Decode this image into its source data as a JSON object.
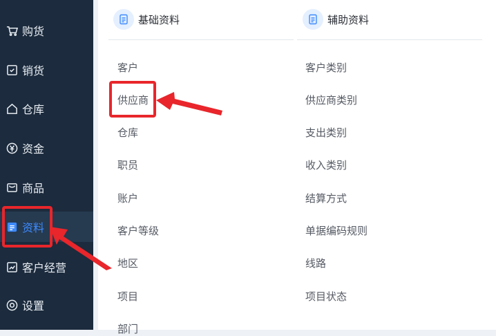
{
  "sidebar": {
    "items": [
      {
        "label": "购货",
        "icon": "cart-icon"
      },
      {
        "label": "销货",
        "icon": "receipt-icon"
      },
      {
        "label": "仓库",
        "icon": "warehouse-icon"
      },
      {
        "label": "资金",
        "icon": "money-icon"
      },
      {
        "label": "商品",
        "icon": "goods-icon"
      },
      {
        "label": "资料",
        "icon": "document-icon",
        "active": true
      },
      {
        "label": "客户经营",
        "icon": "chart-icon"
      },
      {
        "label": "设置",
        "icon": "settings-icon"
      }
    ]
  },
  "columns": [
    {
      "title": "基础资料",
      "icon": "document-icon",
      "items": [
        "客户",
        "供应商",
        "仓库",
        "职员",
        "账户",
        "客户等级",
        "地区",
        "项目",
        "部门"
      ]
    },
    {
      "title": "辅助资料",
      "icon": "document-icon",
      "items": [
        "客户类别",
        "供应商类别",
        "支出类别",
        "收入类别",
        "结算方式",
        "单据编码规则",
        "线路",
        "项目状态"
      ]
    }
  ],
  "colors": {
    "sidebar_bg": "#1c2b3d",
    "active_text": "#3d8bfd",
    "annotation_red": "#e8262b"
  }
}
